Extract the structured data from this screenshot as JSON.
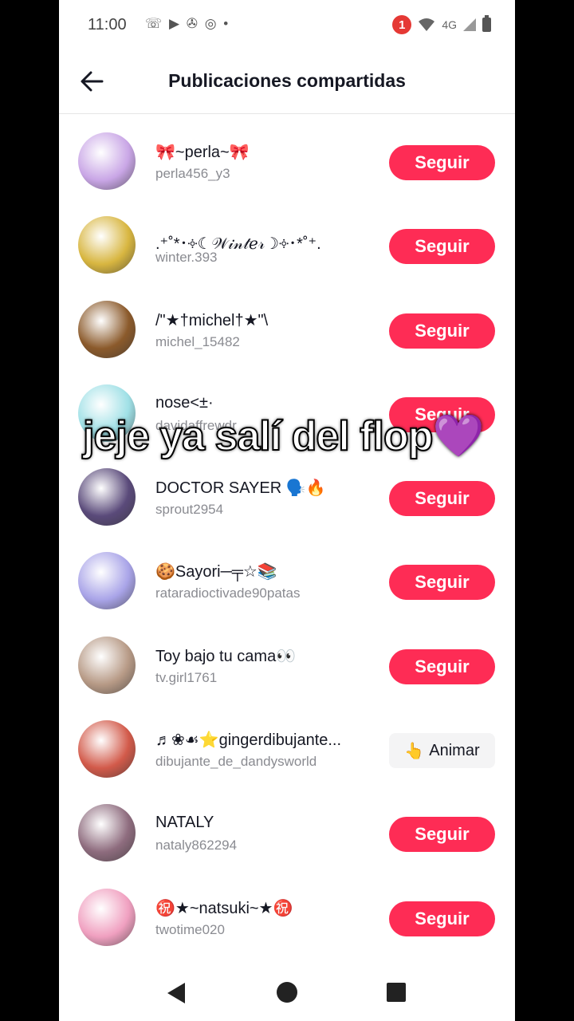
{
  "status_bar": {
    "time": "11:00",
    "app_icons": "☏ ▶ ✇ ◎ •",
    "notification_count": "1",
    "network": "4G"
  },
  "header": {
    "title": "Publicaciones compartidas"
  },
  "users": [
    {
      "nickname": "🎀~perla~🎀",
      "username": "perla456_y3",
      "action": "Seguir",
      "avatar_color": "#c9a6e6"
    },
    {
      "nickname": ".⁺˚*･༓☾𝒲𝒾𝓃𝓉ℯ𝓇☽༓･*˚⁺.",
      "username": "winter.393",
      "action": "Seguir",
      "avatar_color": "#d8b640"
    },
    {
      "nickname": "/\"★†michel†★\"\\",
      "username": "michel_15482",
      "action": "Seguir",
      "avatar_color": "#8b5a2b"
    },
    {
      "nickname": "nose<±·",
      "username": "davidaffrewdr",
      "action": "Seguir",
      "avatar_color": "#9fe0e6"
    },
    {
      "nickname": "DOCTOR SAYER 🗣️🔥",
      "username": "sprout2954",
      "action": "Seguir",
      "avatar_color": "#5a4a7a"
    },
    {
      "nickname": "🍪Sayori─╤☆📚",
      "username": "rataradioctivade90patas",
      "action": "Seguir",
      "avatar_color": "#a9a4e8"
    },
    {
      "nickname": "Toy bajo tu cama👀",
      "username": "tv.girl1761",
      "action": "Seguir",
      "avatar_color": "#b79a86"
    },
    {
      "nickname": "♬❀☙⭐gingerdibujante...",
      "username": "dibujante_de_dandysworld",
      "action": "Animar",
      "action_icon": "👆",
      "avatar_color": "#d25a4a"
    },
    {
      "nickname": "NATALY",
      "username": "nataly862294",
      "action": "Seguir",
      "avatar_color": "#8e6c7e"
    },
    {
      "nickname": "㊗️★~natsuki~★㊗️",
      "username": "twotime020",
      "action": "Seguir",
      "avatar_color": "#f0a0c0"
    }
  ],
  "overlay_text": "jeje ya salí del flop💜",
  "colors": {
    "accent": "#fe2c55",
    "text": "#161823",
    "secondary": "#8a8b91"
  }
}
